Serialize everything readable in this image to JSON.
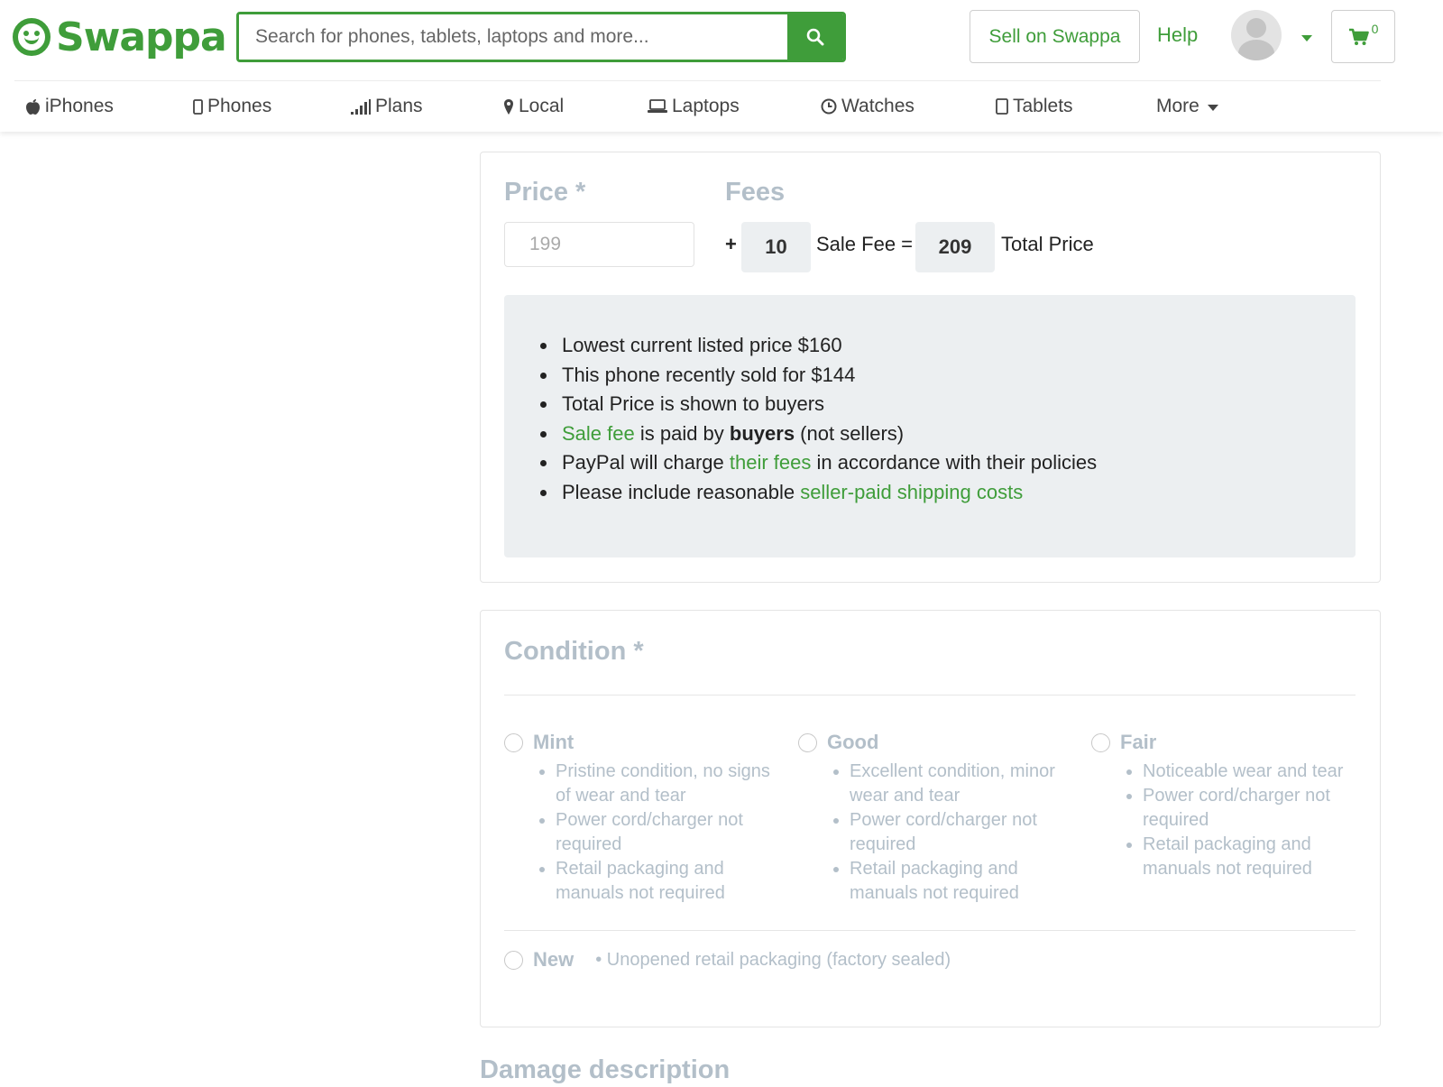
{
  "header": {
    "logo_text": "Swappa",
    "search_placeholder": "Search for phones, tablets, laptops and more...",
    "sell_label": "Sell on Swappa",
    "help_label": "Help",
    "cart_count": "0",
    "brand_color": "#3f9d3a"
  },
  "nav": {
    "items": [
      {
        "label": "iPhones",
        "icon": "apple-icon"
      },
      {
        "label": "Phones",
        "icon": "phone-icon"
      },
      {
        "label": "Plans",
        "icon": "signal-icon"
      },
      {
        "label": "Local",
        "icon": "map-marker-icon"
      },
      {
        "label": "Laptops",
        "icon": "laptop-icon"
      },
      {
        "label": "Watches",
        "icon": "watch-icon"
      },
      {
        "label": "Tablets",
        "icon": "tablet-icon"
      }
    ],
    "more_label": "More"
  },
  "price": {
    "title": "Price *",
    "fees_title": "Fees",
    "input_placeholder": "199",
    "plus": "+",
    "sale_fee_value": "10",
    "sale_fee_label": "Sale Fee =",
    "total_value": "209",
    "total_label": "Total Price",
    "info": {
      "lowest": "Lowest current listed price $160",
      "recent": "This phone recently sold for $144",
      "shown": "Total Price is shown to buyers",
      "sale_fee_link": "Sale fee",
      "sale_fee_mid": " is paid by ",
      "sale_fee_bold": "buyers",
      "sale_fee_end": " (not sellers)",
      "paypal_start": "PayPal will charge ",
      "paypal_link": "their fees",
      "paypal_end": " in accordance with their policies",
      "shipping_start": "Please include reasonable ",
      "shipping_link": "seller-paid shipping costs"
    }
  },
  "condition": {
    "title": "Condition *",
    "options": [
      {
        "name": "Mint",
        "points": [
          "Pristine condition, no signs of wear and tear",
          "Power cord/charger not required",
          "Retail packaging and manuals not required"
        ]
      },
      {
        "name": "Good",
        "points": [
          "Excellent condition, minor wear and tear",
          "Power cord/charger not required",
          "Retail packaging and manuals not required"
        ]
      },
      {
        "name": "Fair",
        "points": [
          "Noticeable wear and tear",
          "Power cord/charger not required",
          "Retail packaging and manuals not required"
        ]
      }
    ],
    "new_option": {
      "name": "New",
      "description": "• Unopened retail packaging (factory sealed)"
    }
  },
  "damage": {
    "title": "Damage description"
  }
}
